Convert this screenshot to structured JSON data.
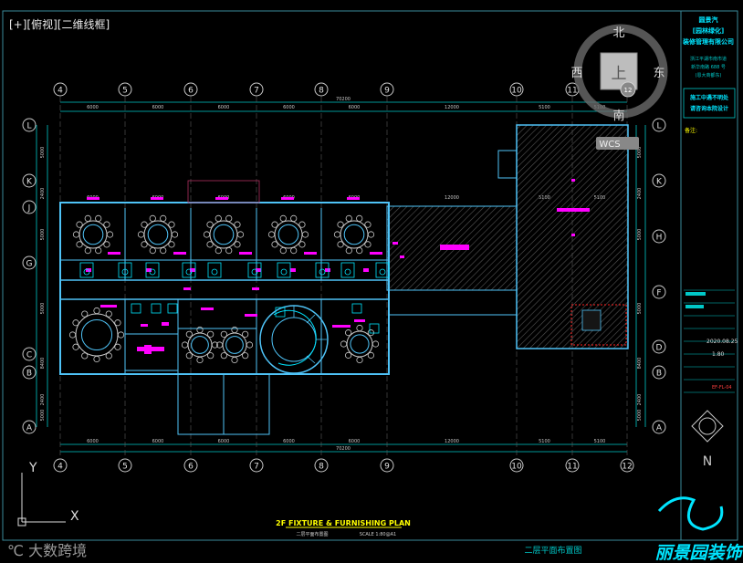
{
  "viewport": {
    "label": "[+][俯视][二维线框]"
  },
  "viewcube": {
    "north": "北",
    "south": "南",
    "east": "东",
    "west": "西",
    "top": "上",
    "wcs": "WCS",
    "mark": "12"
  },
  "axes": {
    "cols": [
      "4",
      "5",
      "6",
      "7",
      "8",
      "9",
      "10",
      "11",
      "12"
    ],
    "rows": [
      "L",
      "K",
      "J",
      "G",
      "C",
      "B",
      "A"
    ],
    "rows_right": [
      "L",
      "K",
      "H",
      "F",
      "D",
      "B",
      "A"
    ],
    "top_dims": [
      "6000",
      "6000",
      "6000",
      "6000",
      "6000",
      "12000",
      "5100",
      "5100"
    ],
    "total_dim": "70200",
    "side_dims": [
      "5000",
      "2400",
      "5000",
      "5000",
      "8400",
      "2400",
      "5000"
    ]
  },
  "plan_title": {
    "en": "2F FIXTURE & FURNISHING PLAN",
    "cn": "二层平面布置图",
    "scale": "SCALE 1:80@A1"
  },
  "title_block": {
    "company1": "圆景汽",
    "company2": "[园林绿化]",
    "company3": "装修管理有限公司",
    "addr1": "浙江平湖市南市道",
    "addr2": "新华南路 688 号",
    "addr3": "(恩大商都东)",
    "warning1": "施工中遇不明处",
    "warning2": "请咨询本院设计",
    "remark": "备注:",
    "date": "2020.08.25",
    "ver": "1.80",
    "sheet": "EF-FL-04",
    "brand": "丽景园装饰",
    "drawing_name": "二层平面布置图"
  },
  "ucs": {
    "y": "Y",
    "x": "X"
  },
  "watermark": "大数跨境",
  "colors": {
    "cyan": "#00e5ff",
    "magenta": "#ff00ff",
    "wall": "#4fc3f7",
    "hatch": "#3a3a3a",
    "yellow": "#ffff00"
  }
}
